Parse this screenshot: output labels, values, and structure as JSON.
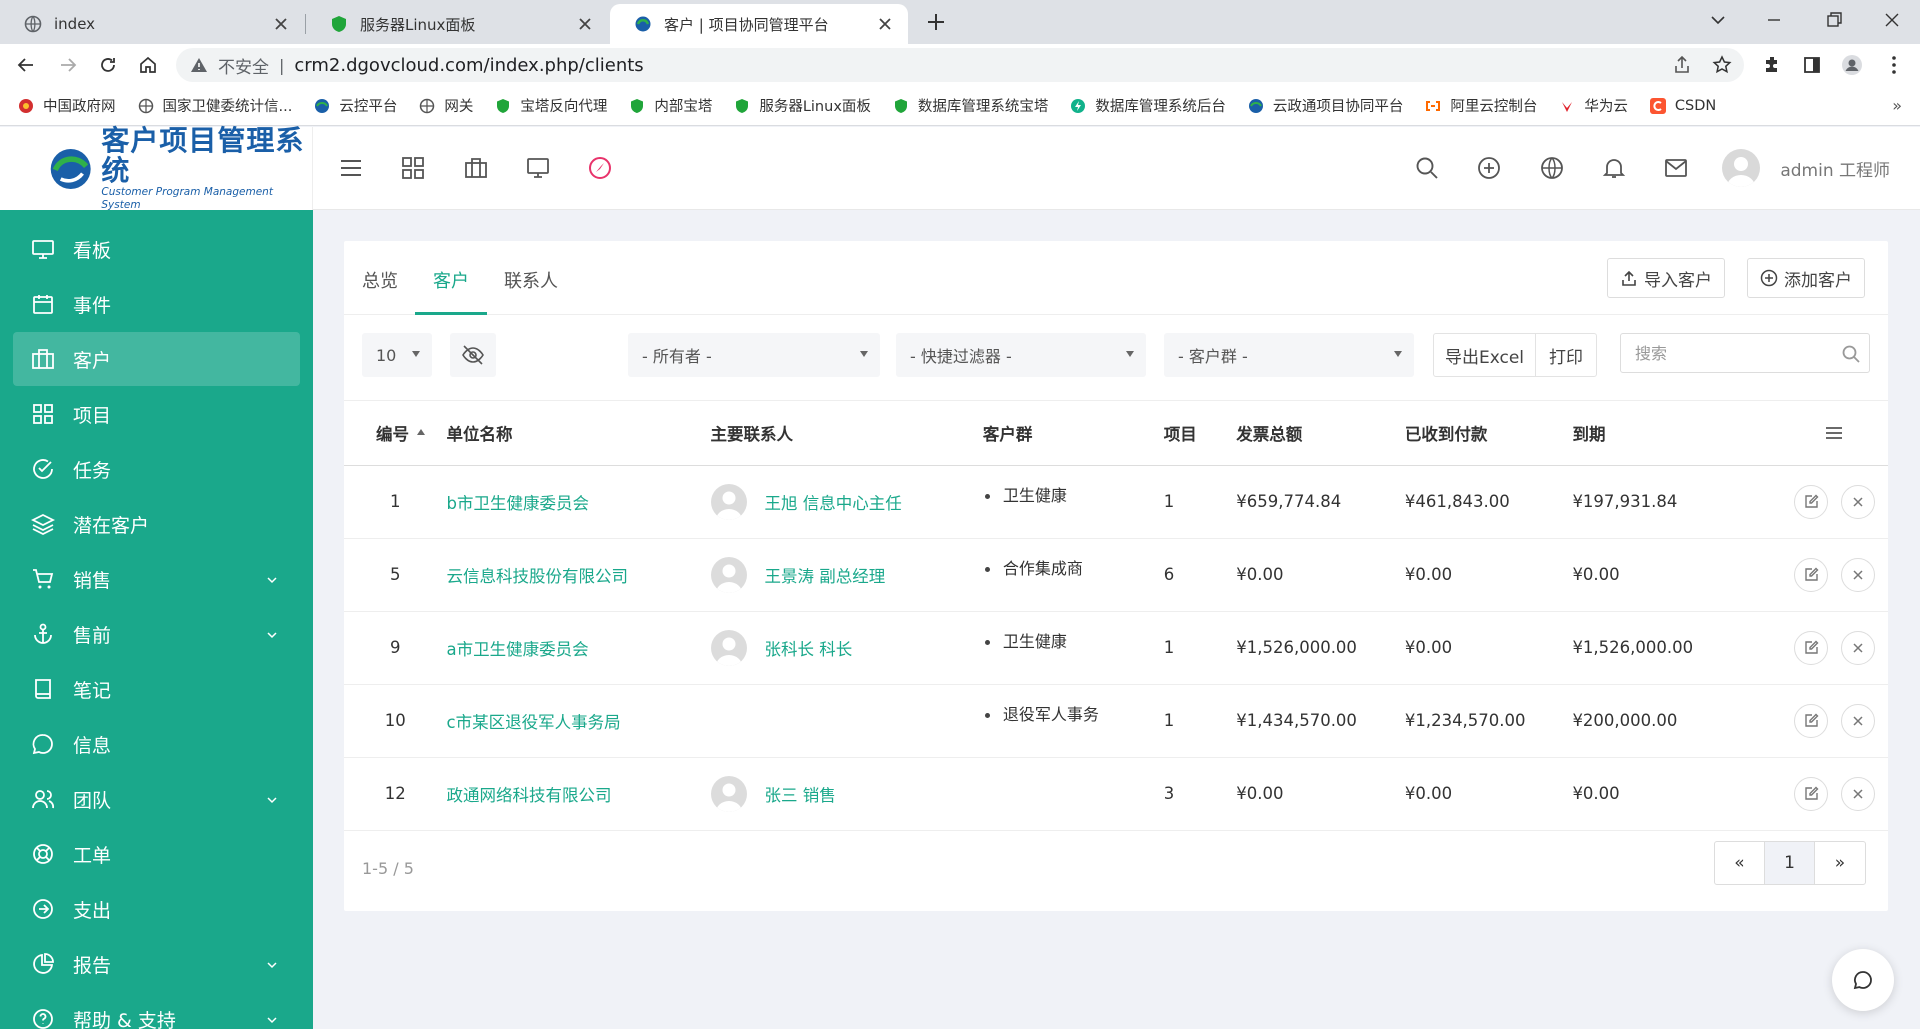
{
  "browser": {
    "tabs": [
      {
        "title": "index",
        "active": false
      },
      {
        "title": "服务器Linux面板",
        "active": false
      },
      {
        "title": "客户 | 项目协同管理平台",
        "active": true
      }
    ],
    "insecure_label": "不安全",
    "url": "crm2.dgovcloud.com/index.php/clients",
    "bookmarks": [
      "中国政府网",
      "国家卫健委统计信...",
      "云控平台",
      "网关",
      "宝塔反向代理",
      "内部宝塔",
      "服务器Linux面板",
      "数据库管理系统宝塔",
      "数据库管理系统后台",
      "云政通项目协同平台",
      "阿里云控制台",
      "华为云",
      "CSDN"
    ],
    "bookmarks_more": "»"
  },
  "app": {
    "logo_cn": "客户项目管理系统",
    "logo_en": "Customer Program Management System",
    "user_name": "admin 工程师"
  },
  "sidebar": {
    "items": [
      {
        "label": "看板",
        "icon": "monitor-icon",
        "active": false
      },
      {
        "label": "事件",
        "icon": "calendar-icon",
        "active": false
      },
      {
        "label": "客户",
        "icon": "briefcase-icon",
        "active": true
      },
      {
        "label": "项目",
        "icon": "grid-icon",
        "active": false
      },
      {
        "label": "任务",
        "icon": "check-circle-icon",
        "active": false
      },
      {
        "label": "潜在客户",
        "icon": "layers-icon",
        "active": false
      },
      {
        "label": "销售",
        "icon": "cart-icon",
        "active": false,
        "expand": true
      },
      {
        "label": "售前",
        "icon": "anchor-icon",
        "active": false,
        "expand": true
      },
      {
        "label": "笔记",
        "icon": "book-icon",
        "active": false
      },
      {
        "label": "信息",
        "icon": "message-icon",
        "active": false
      },
      {
        "label": "团队",
        "icon": "users-icon",
        "active": false,
        "expand": true
      },
      {
        "label": "工单",
        "icon": "lifebuoy-icon",
        "active": false
      },
      {
        "label": "支出",
        "icon": "arrow-circle-icon",
        "active": false
      },
      {
        "label": "报告",
        "icon": "pie-chart-icon",
        "active": false,
        "expand": true
      },
      {
        "label": "帮助 & 支持",
        "icon": "help-icon",
        "active": false,
        "expand": true
      }
    ]
  },
  "content": {
    "tabs": [
      "总览",
      "客户",
      "联系人"
    ],
    "active_tab": "客户",
    "import_label": "导入客户",
    "add_label": "添加客户",
    "page_size": "10",
    "filter_owner": "- 所有者 -",
    "filter_quick": "- 快捷过滤器 -",
    "filter_group": "- 客户群 -",
    "export_label": "导出Excel",
    "print_label": "打印",
    "search_placeholder": "搜索",
    "columns": [
      "编号",
      "单位名称",
      "主要联系人",
      "客户群",
      "项目",
      "发票总额",
      "已收到付款",
      "到期"
    ],
    "rows": [
      {
        "id": "1",
        "name": "b市卫生健康委员会",
        "contact": "王旭 信息中心主任",
        "group": "卫生健康",
        "projects": "1",
        "invoiced": "¥659,774.84",
        "paid": "¥461,843.00",
        "due": "¥197,931.84"
      },
      {
        "id": "5",
        "name": "云信息科技股份有限公司",
        "contact": "王景涛 副总经理",
        "group": "合作集成商",
        "projects": "6",
        "invoiced": "¥0.00",
        "paid": "¥0.00",
        "due": "¥0.00"
      },
      {
        "id": "9",
        "name": "a市卫生健康委员会",
        "contact": "张科长 科长",
        "group": "卫生健康",
        "projects": "1",
        "invoiced": "¥1,526,000.00",
        "paid": "¥0.00",
        "due": "¥1,526,000.00"
      },
      {
        "id": "10",
        "name": "c市某区退役军人事务局",
        "contact": "",
        "group": "退役军人事务",
        "projects": "1",
        "invoiced": "¥1,434,570.00",
        "paid": "¥1,234,570.00",
        "due": "¥200,000.00"
      },
      {
        "id": "12",
        "name": "政通网络科技有限公司",
        "contact": "张三 销售",
        "group": "",
        "projects": "3",
        "invoiced": "¥0.00",
        "paid": "¥0.00",
        "due": "¥0.00"
      }
    ],
    "footer_info": "1-5 / 5",
    "pager": {
      "prev": "«",
      "current": "1",
      "next": "»"
    }
  },
  "colors": {
    "accent": "#1aa88b",
    "sidebar_bg": "#1aa88b",
    "page_bg": "#f0f2f7"
  }
}
